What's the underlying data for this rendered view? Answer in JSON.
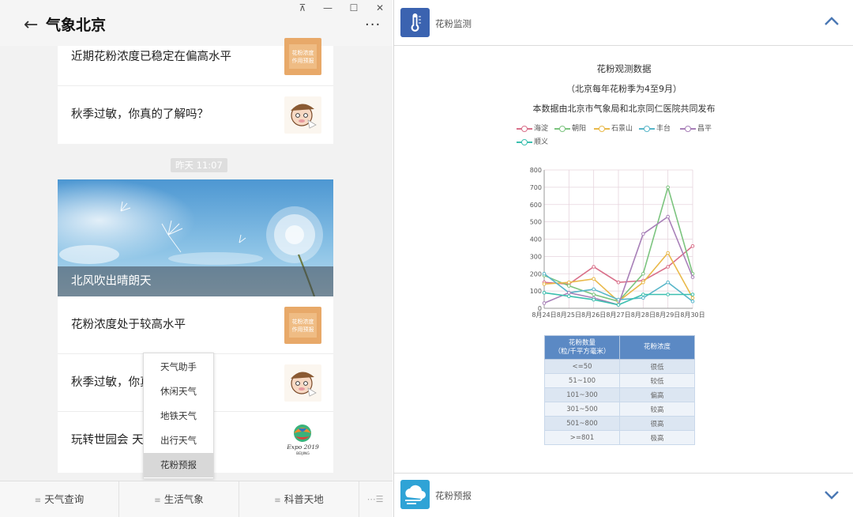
{
  "window": {
    "pin_glyph": "⊼",
    "minimize_glyph": "—",
    "maximize_glyph": "☐",
    "close_glyph": "✕"
  },
  "header": {
    "back_glyph": "←",
    "title": "气象北京",
    "more_glyph": "···"
  },
  "feed": {
    "top_card": [
      {
        "title": "近期花粉浓度已稳定在偏高水平",
        "thumb": "pollen-forecast-thumb"
      },
      {
        "title": "秋季过敏，你真的了解吗？",
        "thumb": "cartoon-thumb"
      }
    ],
    "timestamp": "昨天 11:07",
    "hero": {
      "caption": "北风吹出晴朗天"
    },
    "bottom_card": [
      {
        "title": "花粉浓度处于较高水平",
        "thumb": "pollen-forecast-thumb"
      },
      {
        "title": "秋季过敏，你真",
        "thumb": "cartoon-thumb"
      },
      {
        "title": "玩转世园会 天气",
        "thumb": "expo-logo-thumb"
      }
    ]
  },
  "thumb_text": {
    "pollen": [
      "花粉浓度",
      "作用预报"
    ],
    "expo_main": "Expo 2019",
    "expo_sub": "BEIJING"
  },
  "popup_menu": {
    "items": [
      "天气助手",
      "休闲天气",
      "地铁天气",
      "出行天气",
      "花粉预报"
    ],
    "selected_index": 4
  },
  "bottom_tabs": [
    "天气查询",
    "生活气象",
    "科普天地"
  ],
  "bottom_tabs_keyboard_glyph": "⋯☰",
  "right_panel": {
    "header_title": "花粉监测",
    "footer_title": "花粉预报",
    "chart_title": "花粉观测数据",
    "chart_subtitle": "（北京每年花粉季为4至9月）",
    "chart_source": "本数据由北京市气象局和北京同仁医院共同发布",
    "colors": {
      "header_icon": "#3b63b0",
      "footer_icon": "#2fa3d6",
      "chevron": "#4a78b4"
    }
  },
  "chart_data": {
    "type": "line",
    "categories": [
      "8月24日",
      "8月25日",
      "8月26日",
      "8月27日",
      "8月28日",
      "8月29日",
      "8月30日"
    ],
    "ylim": [
      0,
      800
    ],
    "yticks": [
      0,
      100,
      200,
      300,
      400,
      500,
      600,
      700,
      800
    ],
    "grid": true,
    "legend_position": "top",
    "series": [
      {
        "name": "海淀",
        "color": "#d9708a",
        "values": [
          150,
          140,
          240,
          150,
          160,
          240,
          360
        ]
      },
      {
        "name": "朝阳",
        "color": "#7cc47f",
        "values": [
          190,
          130,
          80,
          40,
          200,
          700,
          200
        ]
      },
      {
        "name": "石景山",
        "color": "#e9b94a",
        "values": [
          140,
          150,
          170,
          40,
          150,
          320,
          60
        ]
      },
      {
        "name": "丰台",
        "color": "#58b6c9",
        "values": [
          200,
          90,
          110,
          50,
          60,
          150,
          40
        ]
      },
      {
        "name": "昌平",
        "color": "#a880b8",
        "values": [
          30,
          90,
          60,
          20,
          430,
          530,
          180
        ]
      },
      {
        "name": "顺义",
        "color": "#3cbfaf",
        "values": [
          90,
          70,
          50,
          20,
          80,
          80,
          80
        ]
      }
    ]
  },
  "pollen_table": {
    "headers": [
      "花粉数量\n（粒/千平方毫米）",
      "花粉浓度"
    ],
    "rows": [
      [
        "<=50",
        "很低"
      ],
      [
        "51~100",
        "较低"
      ],
      [
        "101~300",
        "偏高"
      ],
      [
        "301~500",
        "较高"
      ],
      [
        "501~800",
        "很高"
      ],
      [
        ">=801",
        "极高"
      ]
    ]
  }
}
